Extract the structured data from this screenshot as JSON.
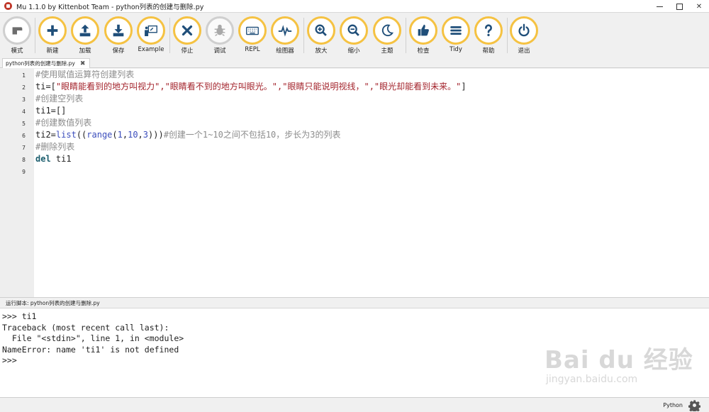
{
  "window": {
    "title": "Mu 1.1.0 by Kittenbot Team - python列表的创建与删除.py"
  },
  "toolbar": {
    "buttons": [
      {
        "label": "模式",
        "icon": "mode-icon"
      },
      {
        "label": "新建",
        "icon": "plus-icon"
      },
      {
        "label": "加载",
        "icon": "upload-icon"
      },
      {
        "label": "保存",
        "icon": "download-icon"
      },
      {
        "label": "Example",
        "icon": "example-icon"
      },
      {
        "label": "停止",
        "icon": "close-icon"
      },
      {
        "label": "调试",
        "icon": "bug-icon"
      },
      {
        "label": "REPL",
        "icon": "keyboard-icon"
      },
      {
        "label": "绘图器",
        "icon": "pulse-icon"
      },
      {
        "label": "放大",
        "icon": "zoom-in-icon"
      },
      {
        "label": "缩小",
        "icon": "zoom-out-icon"
      },
      {
        "label": "主题",
        "icon": "moon-icon"
      },
      {
        "label": "检查",
        "icon": "thumbs-up-icon"
      },
      {
        "label": "Tidy",
        "icon": "menu-icon"
      },
      {
        "label": "帮助",
        "icon": "question-icon"
      },
      {
        "label": "退出",
        "icon": "power-icon"
      }
    ]
  },
  "tab": {
    "filename": "python列表的创建与删除.py",
    "close": "✖"
  },
  "editor": {
    "line_numbers": [
      "1",
      "2",
      "3",
      "4",
      "5",
      "6",
      "7",
      "8",
      "9"
    ],
    "lines": {
      "l1": "#使用赋值运算符创建列表",
      "l2_id": "ti=[",
      "l2_str": "\"眼睛能看到的地方叫视力\",\"眼睛看不到的地方叫眼光。\",\"眼睛只能说明视线，\",\"眼光却能看到未来。\"",
      "l2_end": "]",
      "l3": "#创建空列表",
      "l4": "ti1=[]",
      "l5": "#创建数值列表",
      "l6_id": "ti2=",
      "l6_fn1": "list",
      "l6_p1": "((",
      "l6_fn2": "range",
      "l6_p2": "(",
      "l6_n1": "1",
      "l6_c1": ",",
      "l6_n2": "10",
      "l6_c2": ",",
      "l6_n3": "3",
      "l6_p3": ")))",
      "l6_com": "#创建一个1~10之间不包括10，步长为3的列表",
      "l7": "#删除列表",
      "l8_kw": "del",
      "l8_id": " ti1"
    }
  },
  "repl": {
    "header": "运行脚本: python列表的创建与删除.py",
    "lines": [
      ">>> ti1",
      "Traceback (most recent call last):",
      "  File \"<stdin>\", line 1, in <module>",
      "NameError: name 'ti1' is not defined",
      ">>>"
    ]
  },
  "watermark": {
    "main": "Bai du 经验",
    "sub": "jingyan.baidu.com"
  },
  "status": {
    "mode": "Python"
  },
  "colors": {
    "button_ring": "#f5c242",
    "comment": "#8c8c8c",
    "string": "#a3232b",
    "builtin": "#3b4dbc",
    "keyword": "#1b5d6d"
  }
}
